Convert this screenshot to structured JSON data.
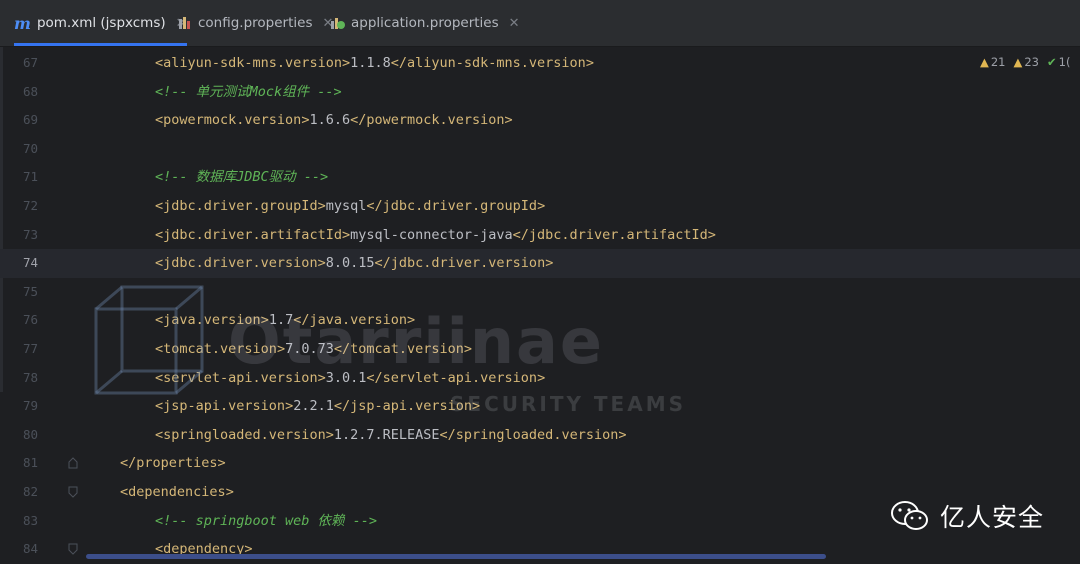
{
  "tabs": [
    {
      "label": "pom.xml (jspxcms)",
      "icon": "maven-icon",
      "active": true
    },
    {
      "label": "config.properties",
      "icon": "properties-icon",
      "active": false
    },
    {
      "label": "application.properties",
      "icon": "spring-properties-icon",
      "active": false
    }
  ],
  "inspection": {
    "warnings": "21",
    "weak_warnings": "23",
    "ok": "1("
  },
  "lines": [
    {
      "num": "67",
      "indent": 2,
      "parts": [
        [
          "br",
          "<"
        ],
        [
          "tn",
          "aliyun-sdk-mns.version"
        ],
        [
          "br",
          ">"
        ],
        [
          "txt",
          "1.1.8"
        ],
        [
          "br",
          "</"
        ],
        [
          "tn",
          "aliyun-sdk-mns.version"
        ],
        [
          "br",
          ">"
        ]
      ]
    },
    {
      "num": "68",
      "indent": 2,
      "parts": [
        [
          "cmt",
          "<!-- 单元测试Mock组件 -->"
        ]
      ]
    },
    {
      "num": "69",
      "indent": 2,
      "parts": [
        [
          "br",
          "<"
        ],
        [
          "tn",
          "powermock.version"
        ],
        [
          "br",
          ">"
        ],
        [
          "txt",
          "1.6.6"
        ],
        [
          "br",
          "</"
        ],
        [
          "tn",
          "powermock.version"
        ],
        [
          "br",
          ">"
        ]
      ]
    },
    {
      "num": "70",
      "indent": 2,
      "parts": []
    },
    {
      "num": "71",
      "indent": 2,
      "parts": [
        [
          "cmt",
          "<!-- 数据库JDBC驱动 -->"
        ]
      ]
    },
    {
      "num": "72",
      "indent": 2,
      "parts": [
        [
          "br",
          "<"
        ],
        [
          "tn",
          "jdbc.driver.groupId"
        ],
        [
          "br",
          ">"
        ],
        [
          "txt",
          "mysql"
        ],
        [
          "br",
          "</"
        ],
        [
          "tn",
          "jdbc.driver.groupId"
        ],
        [
          "br",
          ">"
        ]
      ]
    },
    {
      "num": "73",
      "indent": 2,
      "parts": [
        [
          "br",
          "<"
        ],
        [
          "tn",
          "jdbc.driver.artifactId"
        ],
        [
          "br",
          ">"
        ],
        [
          "txt",
          "mysql-connector-java"
        ],
        [
          "br",
          "</"
        ],
        [
          "tn",
          "jdbc.driver.artifactId"
        ],
        [
          "br",
          ">"
        ]
      ]
    },
    {
      "num": "74",
      "indent": 2,
      "parts": [
        [
          "br",
          "<"
        ],
        [
          "tn",
          "jdbc.driver.version"
        ],
        [
          "br",
          ">"
        ],
        [
          "txt",
          "8.0.15"
        ],
        [
          "br",
          "</"
        ],
        [
          "tn",
          "jdbc.driver.version"
        ],
        [
          "br",
          ">"
        ]
      ]
    },
    {
      "num": "75",
      "indent": 2,
      "parts": []
    },
    {
      "num": "76",
      "indent": 2,
      "parts": [
        [
          "br",
          "<"
        ],
        [
          "tn",
          "java.version"
        ],
        [
          "br",
          ">"
        ],
        [
          "txt",
          "1.7"
        ],
        [
          "br",
          "</"
        ],
        [
          "tn",
          "java.version"
        ],
        [
          "br",
          ">"
        ]
      ]
    },
    {
      "num": "77",
      "indent": 2,
      "parts": [
        [
          "br",
          "<"
        ],
        [
          "tn",
          "tomcat.version"
        ],
        [
          "br",
          ">"
        ],
        [
          "txt",
          "7.0.73"
        ],
        [
          "br",
          "</"
        ],
        [
          "tn",
          "tomcat.version"
        ],
        [
          "br",
          ">"
        ]
      ]
    },
    {
      "num": "78",
      "indent": 2,
      "parts": [
        [
          "br",
          "<"
        ],
        [
          "tn",
          "servlet-api.version"
        ],
        [
          "br",
          ">"
        ],
        [
          "txt",
          "3.0.1"
        ],
        [
          "br",
          "</"
        ],
        [
          "tn",
          "servlet-api.version"
        ],
        [
          "br",
          ">"
        ]
      ]
    },
    {
      "num": "79",
      "indent": 2,
      "parts": [
        [
          "br",
          "<"
        ],
        [
          "tn",
          "jsp-api.version"
        ],
        [
          "br",
          ">"
        ],
        [
          "txt",
          "2.2.1"
        ],
        [
          "br",
          "</"
        ],
        [
          "tn",
          "jsp-api.version"
        ],
        [
          "br",
          ">"
        ]
      ]
    },
    {
      "num": "80",
      "indent": 2,
      "parts": [
        [
          "br",
          "<"
        ],
        [
          "tn",
          "springloaded.version"
        ],
        [
          "br",
          ">"
        ],
        [
          "txt",
          "1.2.7.RELEASE"
        ],
        [
          "br",
          "</"
        ],
        [
          "tn",
          "springloaded.version"
        ],
        [
          "br",
          ">"
        ]
      ]
    },
    {
      "num": "81",
      "indent": 1,
      "fold": "close",
      "parts": [
        [
          "br",
          "</"
        ],
        [
          "tn",
          "properties"
        ],
        [
          "br",
          ">"
        ]
      ]
    },
    {
      "num": "82",
      "indent": 1,
      "fold": "open",
      "parts": [
        [
          "br",
          "<"
        ],
        [
          "tn",
          "dependencies"
        ],
        [
          "br",
          ">"
        ]
      ]
    },
    {
      "num": "83",
      "indent": 2,
      "parts": [
        [
          "cmt",
          "<!-- springboot web 依赖 -->"
        ]
      ]
    },
    {
      "num": "84",
      "indent": 2,
      "fold": "open",
      "parts": [
        [
          "br",
          "<"
        ],
        [
          "tn",
          "dependency"
        ],
        [
          "br",
          ">"
        ]
      ]
    }
  ],
  "current_line": "74",
  "watermark": {
    "main": "Otarriinae",
    "sub": "SECURITY TEAMS"
  },
  "brand": {
    "name": "亿人安全",
    "icon": "wechat-icon"
  }
}
